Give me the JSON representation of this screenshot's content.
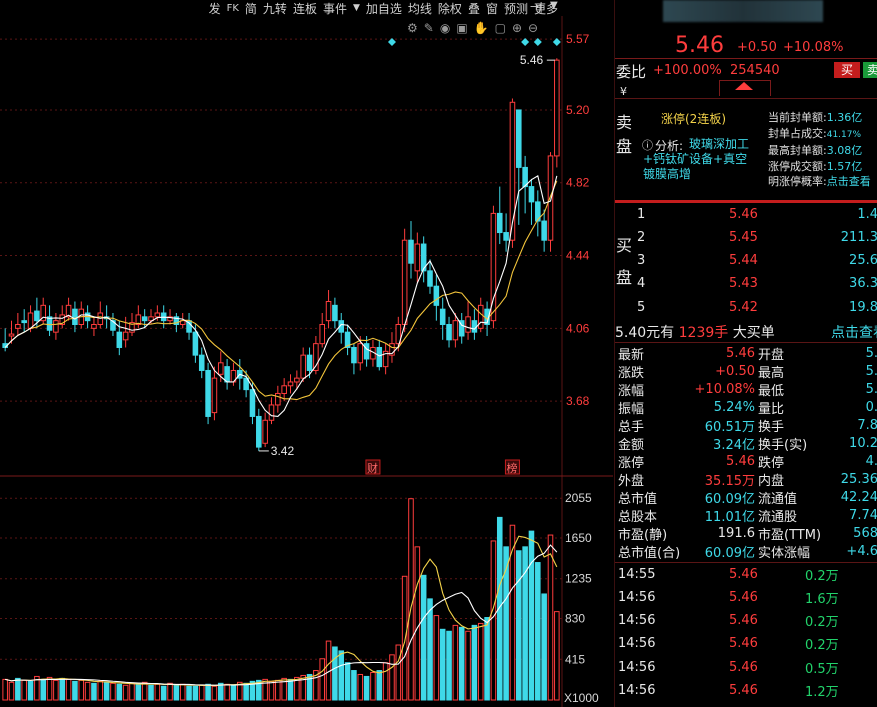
{
  "toolbar": {
    "items": [
      "发",
      "FK",
      "简",
      "九转",
      "连板",
      "事件",
      "▼",
      "加自选",
      "均线",
      "除权",
      "叠",
      "窗",
      "预测",
      "更多"
    ],
    "icons": [
      "settings-icon",
      "pen-icon",
      "eye-icon",
      "trash-icon",
      "hand-icon",
      "lock-icon",
      "zoom-in-icon",
      "zoom-out-icon"
    ]
  },
  "chart": {
    "price_axis": [
      "5.57",
      "5.20",
      "4.82",
      "4.44",
      "4.06",
      "3.68"
    ],
    "volume_axis": [
      "2055",
      "1650",
      "1235",
      "830",
      "415",
      "X1000"
    ],
    "last_price_marker": "5.46",
    "low_marker": "3.42",
    "event_tags": [
      "财",
      "榜"
    ],
    "colors": {
      "up": "#ff3d3d",
      "down": "#3fd9e8",
      "ma5": "#ffffff",
      "ma10": "#f3c53b",
      "grid": "#5a1515"
    }
  },
  "chart_data": {
    "type": "candlestick",
    "price_ylim": [
      3.31,
      5.68
    ],
    "volume_ylim": [
      0,
      2200
    ],
    "candles": [
      [
        3.98,
        3.96,
        4.06,
        3.94
      ],
      [
        4.02,
        4.03,
        4.1,
        3.98
      ],
      [
        4.06,
        4.08,
        4.14,
        4.02
      ],
      [
        4.1,
        4.09,
        4.16,
        4.04
      ],
      [
        4.06,
        4.14,
        4.18,
        4.04
      ],
      [
        4.15,
        4.1,
        4.22,
        4.06
      ],
      [
        4.1,
        4.18,
        4.22,
        4.08
      ],
      [
        4.12,
        4.05,
        4.18,
        4.02
      ],
      [
        4.04,
        4.1,
        4.14,
        4.0
      ],
      [
        4.08,
        4.13,
        4.18,
        4.06
      ],
      [
        4.12,
        4.18,
        4.22,
        4.1
      ],
      [
        4.16,
        4.08,
        4.2,
        4.04
      ],
      [
        4.08,
        4.16,
        4.2,
        4.06
      ],
      [
        4.14,
        4.1,
        4.18,
        4.06
      ],
      [
        4.06,
        4.08,
        4.12,
        4.02
      ],
      [
        4.08,
        4.14,
        4.2,
        4.06
      ],
      [
        4.12,
        4.11,
        4.18,
        4.06
      ],
      [
        4.1,
        4.05,
        4.14,
        4.02
      ],
      [
        4.04,
        3.96,
        4.1,
        3.92
      ],
      [
        4.0,
        4.04,
        4.12,
        3.96
      ],
      [
        4.04,
        4.09,
        4.14,
        4.02
      ],
      [
        4.08,
        4.13,
        4.18,
        4.06
      ],
      [
        4.12,
        4.1,
        4.16,
        4.06
      ],
      [
        4.1,
        4.12,
        4.16,
        4.08
      ],
      [
        4.12,
        4.14,
        4.18,
        4.1
      ],
      [
        4.14,
        4.1,
        4.18,
        4.06
      ],
      [
        4.1,
        4.12,
        4.16,
        4.08
      ],
      [
        4.12,
        4.08,
        4.14,
        4.04
      ],
      [
        4.08,
        4.1,
        4.14,
        4.06
      ],
      [
        4.1,
        4.04,
        4.14,
        4.0
      ],
      [
        4.04,
        3.92,
        4.08,
        3.88
      ],
      [
        3.92,
        3.84,
        3.96,
        3.8
      ],
      [
        3.84,
        3.6,
        3.88,
        3.56
      ],
      [
        3.62,
        3.8,
        3.86,
        3.58
      ],
      [
        3.82,
        3.88,
        3.94,
        3.78
      ],
      [
        3.86,
        3.78,
        3.9,
        3.74
      ],
      [
        3.78,
        3.84,
        3.88,
        3.76
      ],
      [
        3.84,
        3.8,
        3.9,
        3.74
      ],
      [
        3.8,
        3.74,
        3.84,
        3.7
      ],
      [
        3.74,
        3.6,
        3.78,
        3.56
      ],
      [
        3.6,
        3.44,
        3.64,
        3.42
      ],
      [
        3.46,
        3.58,
        3.62,
        3.44
      ],
      [
        3.58,
        3.66,
        3.7,
        3.56
      ],
      [
        3.66,
        3.72,
        3.76,
        3.62
      ],
      [
        3.72,
        3.76,
        3.8,
        3.68
      ],
      [
        3.76,
        3.78,
        3.82,
        3.72
      ],
      [
        3.78,
        3.8,
        3.84,
        3.74
      ],
      [
        3.8,
        3.92,
        3.96,
        3.78
      ],
      [
        3.92,
        3.84,
        3.96,
        3.8
      ],
      [
        3.84,
        3.98,
        4.02,
        3.82
      ],
      [
        3.98,
        4.08,
        4.14,
        3.96
      ],
      [
        4.1,
        4.2,
        4.26,
        4.06
      ],
      [
        4.18,
        4.1,
        4.22,
        4.06
      ],
      [
        4.1,
        4.04,
        4.14,
        3.98
      ],
      [
        4.04,
        3.96,
        4.08,
        3.92
      ],
      [
        3.96,
        3.88,
        3.98,
        3.82
      ],
      [
        3.88,
        3.98,
        4.02,
        3.84
      ],
      [
        3.98,
        3.9,
        4.02,
        3.86
      ],
      [
        3.9,
        3.96,
        4.0,
        3.86
      ],
      [
        3.96,
        3.86,
        4.0,
        3.84
      ],
      [
        3.86,
        3.94,
        3.98,
        3.82
      ],
      [
        3.92,
        3.98,
        4.04,
        3.88
      ],
      [
        3.98,
        4.08,
        4.12,
        3.94
      ],
      [
        4.08,
        4.52,
        4.58,
        4.04
      ],
      [
        4.52,
        4.4,
        4.62,
        4.32
      ],
      [
        4.36,
        4.5,
        4.56,
        4.3
      ],
      [
        4.5,
        4.36,
        4.54,
        4.3
      ],
      [
        4.36,
        4.28,
        4.42,
        4.24
      ],
      [
        4.28,
        4.18,
        4.34,
        4.1
      ],
      [
        4.16,
        4.08,
        4.22,
        4.0
      ],
      [
        4.08,
        4.0,
        4.12,
        3.96
      ],
      [
        4.0,
        4.1,
        4.14,
        3.96
      ],
      [
        4.1,
        4.02,
        4.14,
        3.98
      ],
      [
        4.04,
        4.12,
        4.2,
        4.0
      ],
      [
        4.1,
        4.04,
        4.16,
        4.0
      ],
      [
        4.06,
        4.18,
        4.22,
        4.04
      ],
      [
        4.16,
        4.08,
        4.2,
        4.02
      ],
      [
        4.1,
        4.66,
        4.7,
        4.06
      ],
      [
        4.66,
        4.56,
        4.8,
        4.5
      ],
      [
        4.56,
        4.52,
        4.66,
        4.46
      ],
      [
        4.52,
        5.24,
        5.26,
        4.48
      ],
      [
        5.2,
        4.9,
        5.02,
        4.6
      ],
      [
        4.9,
        4.8,
        4.96,
        4.66
      ],
      [
        4.8,
        4.72,
        4.84,
        4.6
      ],
      [
        4.72,
        4.62,
        4.78,
        4.54
      ],
      [
        4.62,
        4.52,
        4.68,
        4.46
      ],
      [
        4.52,
        4.96,
        4.98,
        4.46
      ],
      [
        4.96,
        5.46,
        5.47,
        4.9
      ]
    ],
    "volumes": [
      [
        210,
        1
      ],
      [
        180,
        1
      ],
      [
        220,
        0
      ],
      [
        200,
        1
      ],
      [
        190,
        0
      ],
      [
        240,
        1
      ],
      [
        210,
        0
      ],
      [
        230,
        1
      ],
      [
        200,
        1
      ],
      [
        220,
        0
      ],
      [
        210,
        1
      ],
      [
        190,
        0
      ],
      [
        200,
        1
      ],
      [
        180,
        1
      ],
      [
        170,
        0
      ],
      [
        190,
        1
      ],
      [
        180,
        0
      ],
      [
        170,
        1
      ],
      [
        160,
        0
      ],
      [
        150,
        1
      ],
      [
        170,
        1
      ],
      [
        160,
        0
      ],
      [
        180,
        1
      ],
      [
        150,
        0
      ],
      [
        160,
        1
      ],
      [
        140,
        0
      ],
      [
        170,
        1
      ],
      [
        150,
        0
      ],
      [
        160,
        1
      ],
      [
        140,
        0
      ],
      [
        140,
        0
      ],
      [
        150,
        1
      ],
      [
        160,
        0
      ],
      [
        140,
        1
      ],
      [
        170,
        0
      ],
      [
        160,
        1
      ],
      [
        150,
        0
      ],
      [
        180,
        1
      ],
      [
        170,
        0
      ],
      [
        190,
        0
      ],
      [
        200,
        0
      ],
      [
        210,
        1
      ],
      [
        190,
        1
      ],
      [
        200,
        1
      ],
      [
        220,
        1
      ],
      [
        210,
        0
      ],
      [
        230,
        1
      ],
      [
        250,
        1
      ],
      [
        260,
        0
      ],
      [
        300,
        1
      ],
      [
        420,
        1
      ],
      [
        600,
        1
      ],
      [
        540,
        0
      ],
      [
        500,
        0
      ],
      [
        380,
        0
      ],
      [
        300,
        0
      ],
      [
        260,
        1
      ],
      [
        240,
        0
      ],
      [
        280,
        1
      ],
      [
        300,
        0
      ],
      [
        380,
        1
      ],
      [
        460,
        1
      ],
      [
        560,
        1
      ],
      [
        1260,
        1
      ],
      [
        2050,
        1
      ],
      [
        1560,
        1
      ],
      [
        1270,
        0
      ],
      [
        1030,
        0
      ],
      [
        860,
        1
      ],
      [
        720,
        0
      ],
      [
        700,
        0
      ],
      [
        760,
        1
      ],
      [
        740,
        0
      ],
      [
        700,
        1
      ],
      [
        760,
        0
      ],
      [
        780,
        1
      ],
      [
        840,
        0
      ],
      [
        1620,
        1
      ],
      [
        1860,
        0
      ],
      [
        1560,
        0
      ],
      [
        1780,
        1
      ],
      [
        1520,
        0
      ],
      [
        1560,
        0
      ],
      [
        1720,
        0
      ],
      [
        1400,
        0
      ],
      [
        1080,
        0
      ],
      [
        1680,
        1
      ],
      [
        900,
        1
      ]
    ]
  },
  "header": {
    "stock_name_masked": "********  002615",
    "price": "5.46",
    "change": "+0.50",
    "change_pct": "+10.08%",
    "weibi_label": "委比",
    "weibi_value": "+100.00%",
    "weicha_value": "254540",
    "buy_btn": "买",
    "sell_btn": "卖",
    "yen_label": "¥"
  },
  "limitup": {
    "side_labels": [
      "卖",
      "盘"
    ],
    "title": "涨停(2连板)",
    "analysis_label": "分析:",
    "analysis_text": "玻璃深加工+钙钛矿设备+真空镀膜高增",
    "stats": [
      {
        "label": "当前封单额:",
        "value": "1.36亿"
      },
      {
        "label": "封单占成交:",
        "value": "41.17%"
      },
      {
        "label": "最高封单额:",
        "value": "3.08亿"
      },
      {
        "label": "涨停成交额:",
        "value": "1.57亿"
      },
      {
        "label": "明涨停概率:",
        "value": "点击查看"
      }
    ]
  },
  "bids": {
    "side_labels": [
      "买",
      "盘"
    ],
    "rows": [
      {
        "level": "1",
        "price": "5.46",
        "vol": "1.4"
      },
      {
        "level": "2",
        "price": "5.45",
        "vol": "211.3"
      },
      {
        "level": "3",
        "price": "5.44",
        "vol": "25.6"
      },
      {
        "level": "4",
        "price": "5.43",
        "vol": "36.3"
      },
      {
        "level": "5",
        "price": "5.42",
        "vol": "19.8"
      }
    ],
    "big_order": {
      "price_text": "5.40元有",
      "qty": "1239手",
      "label": "大买单",
      "link": "点击查看"
    }
  },
  "quote": {
    "rows": [
      {
        "l1": "最新",
        "v1": "5.46",
        "c1": "red",
        "l2": "开盘",
        "v2": "5."
      },
      {
        "l1": "涨跌",
        "v1": "+0.50",
        "c1": "red",
        "l2": "最高",
        "v2": "5."
      },
      {
        "l1": "涨幅",
        "v1": "+10.08%",
        "c1": "red",
        "l2": "最低",
        "v2": "5."
      },
      {
        "l1": "振幅",
        "v1": "5.24%",
        "c1": "cyan",
        "l2": "量比",
        "v2": "0."
      },
      {
        "l1": "总手",
        "v1": "60.51万",
        "c1": "cyan",
        "l2": "换手",
        "v2": "7.8"
      },
      {
        "l1": "金额",
        "v1": "3.24亿",
        "c1": "cyan",
        "l2": "换手(实)",
        "v2": "10.2"
      },
      {
        "l1": "涨停",
        "v1": "5.46",
        "c1": "red",
        "l2": "跌停",
        "v2": "4."
      },
      {
        "l1": "外盘",
        "v1": "35.15万",
        "c1": "red",
        "l2": "内盘",
        "v2": "25.36"
      },
      {
        "l1": "总市值",
        "v1": "60.09亿",
        "c1": "cyan",
        "l2": "流通值",
        "v2": "42.24"
      },
      {
        "l1": "总股本",
        "v1": "11.01亿",
        "c1": "cyan",
        "l2": "流通股",
        "v2": "7.74"
      },
      {
        "l1": "市盈(静)",
        "v1": "191.6",
        "c1": "white",
        "l2": "市盈(TTM)",
        "v2": "568"
      },
      {
        "l1": "总市值(合)",
        "v1": "60.09亿",
        "c1": "cyan",
        "l2": "实体涨幅",
        "v2": "+4.6"
      }
    ]
  },
  "ticks": [
    {
      "time": "14:55",
      "price": "5.46",
      "vol": "0.2万"
    },
    {
      "time": "14:56",
      "price": "5.46",
      "vol": "1.6万"
    },
    {
      "time": "14:56",
      "price": "5.46",
      "vol": "0.2万"
    },
    {
      "time": "14:56",
      "price": "5.46",
      "vol": "0.2万"
    },
    {
      "time": "14:56",
      "price": "5.46",
      "vol": "0.5万"
    },
    {
      "time": "14:56",
      "price": "5.46",
      "vol": "1.2万"
    }
  ]
}
